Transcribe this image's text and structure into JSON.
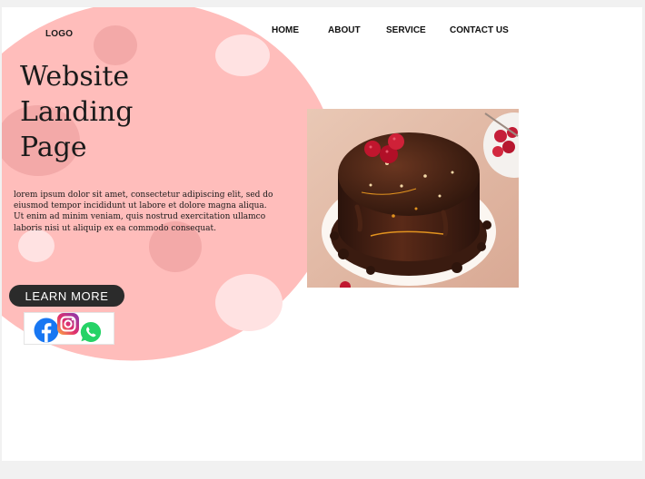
{
  "header": {
    "logo": "LOGO",
    "nav": [
      {
        "label": "HOME"
      },
      {
        "label": "ABOUT"
      },
      {
        "label": "SERVICE"
      },
      {
        "label": "CONTACT US"
      }
    ]
  },
  "hero": {
    "title_lines": [
      "Website",
      "Landing",
      "Page"
    ],
    "description": "lorem ipsum dolor sit amet, consectetur adipiscing elit, sed do eiusmod tempor incididunt ut labore et dolore magna aliqua. Ut enim ad minim veniam, quis nostrud exercitation ullamco laboris nisi ut aliquip ex ea commodo consequat.",
    "cta_label": "LEARN MORE"
  },
  "social": {
    "icons": [
      "facebook-icon",
      "instagram-icon",
      "whatsapp-icon"
    ]
  },
  "image": {
    "subject": "chocolate-cake-with-raspberries"
  },
  "colors": {
    "blob": "#ffbdbb",
    "bubble_dark": "#f3a9a8",
    "bubble_light": "#ffe2e2",
    "button": "#2b2b2b",
    "facebook": "#1877f2",
    "whatsapp": "#25d366",
    "instagram": "#c13584"
  }
}
